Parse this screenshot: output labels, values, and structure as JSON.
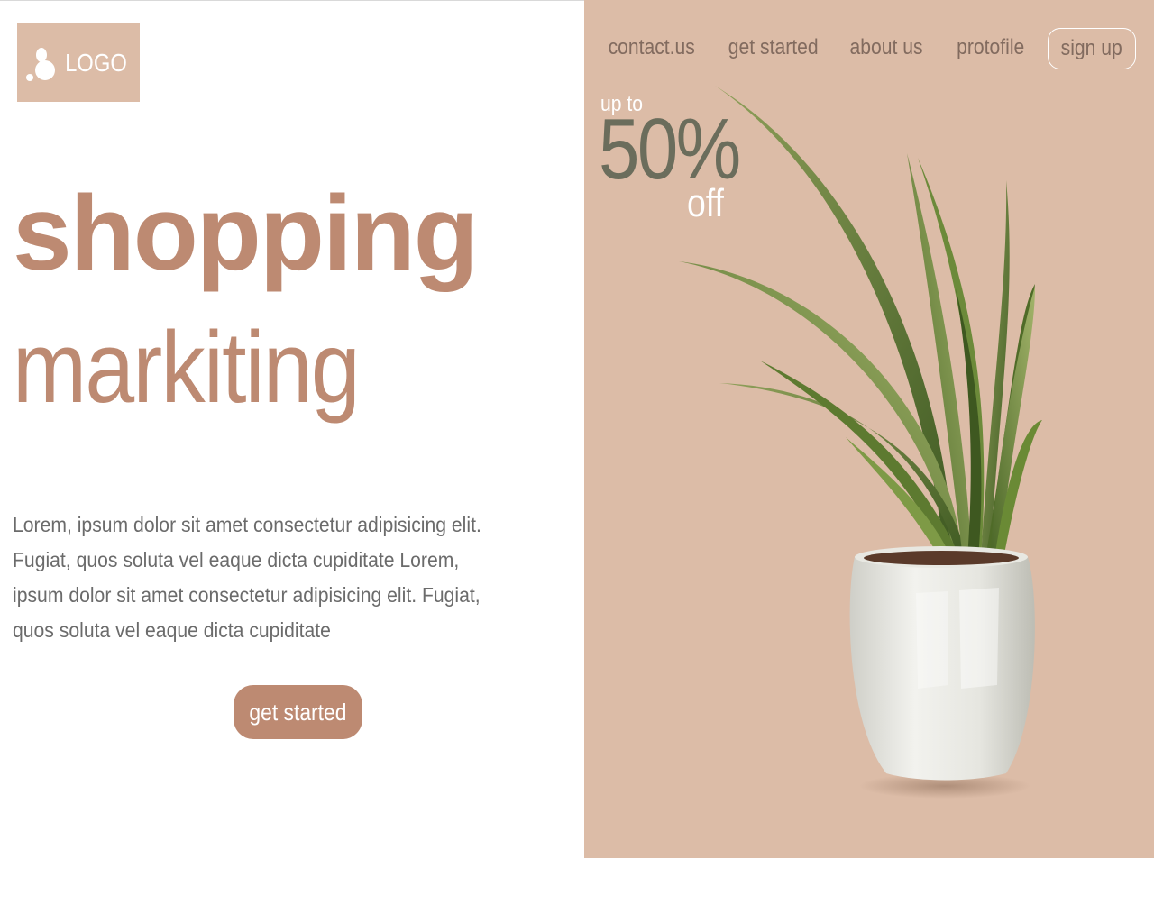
{
  "header": {
    "logo_text": "LOGO",
    "logo_icon": "logo-mark-icon"
  },
  "nav": {
    "items": [
      {
        "label": "contact.us"
      },
      {
        "label": "get started"
      },
      {
        "label": "about us"
      },
      {
        "label": "protofile"
      }
    ],
    "signup_label": "sign up"
  },
  "hero": {
    "title_bold": "shopping",
    "title_light": "markiting",
    "description": "Lorem, ipsum dolor sit amet consectetur adipisicing elit. Fugiat, quos soluta vel eaque dicta cupiditate Lorem, ipsum dolor sit amet consectetur adipisicing elit. Fugiat, quos soluta vel eaque dicta cupiditate",
    "cta_label": "get started"
  },
  "promo": {
    "prefix": "up to",
    "percent": "50%",
    "suffix": "off"
  },
  "image": {
    "subject": "potted-plant-image"
  },
  "colors": {
    "accent": "#bd8a72",
    "panel": "#dcbca7",
    "text": "#6b6b6b",
    "nav_text": "#826b5f",
    "percent": "#6b6d5c"
  }
}
